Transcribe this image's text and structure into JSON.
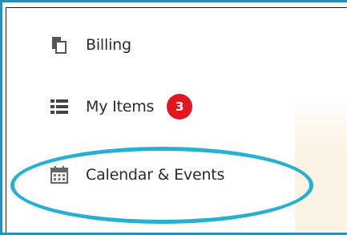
{
  "menu": {
    "items": [
      {
        "label": "Billing",
        "icon": "billing-icon"
      },
      {
        "label": "My Items",
        "icon": "list-icon",
        "badge": "3"
      },
      {
        "label": "Calendar & Events",
        "icon": "calendar-icon"
      }
    ]
  },
  "colors": {
    "frame_border": "#2a8fb8",
    "badge": "#e0171f",
    "highlight_ring": "#26b0d2",
    "text": "#2b2b2b"
  }
}
